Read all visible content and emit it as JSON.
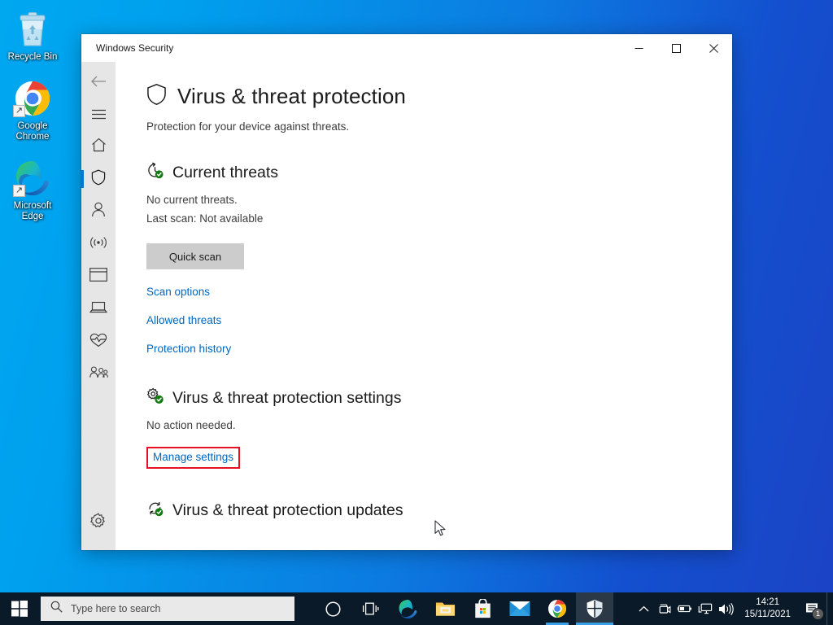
{
  "desktop": {
    "icons": [
      {
        "name": "recycle-bin",
        "label": "Recycle Bin"
      },
      {
        "name": "google-chrome",
        "label": "Google Chrome"
      },
      {
        "name": "microsoft-edge",
        "label": "Microsoft Edge"
      }
    ]
  },
  "window": {
    "title": "Windows Security",
    "controls": {
      "minimize": "—",
      "maximize": "☐",
      "close": "✕"
    }
  },
  "sidebar": {
    "items": [
      {
        "name": "back-arrow-icon",
        "label": "Back"
      },
      {
        "name": "hamburger-menu-icon",
        "label": "Menu"
      },
      {
        "name": "home-icon",
        "label": "Home"
      },
      {
        "name": "shield-icon",
        "label": "Virus & threat protection"
      },
      {
        "name": "person-icon",
        "label": "Account protection"
      },
      {
        "name": "wifi-icon",
        "label": "Firewall & network protection"
      },
      {
        "name": "app-window-icon",
        "label": "App & browser control"
      },
      {
        "name": "laptop-icon",
        "label": "Device security"
      },
      {
        "name": "heart-pulse-icon",
        "label": "Device performance & health"
      },
      {
        "name": "family-icon",
        "label": "Family options"
      },
      {
        "name": "gear-icon",
        "label": "Settings"
      }
    ]
  },
  "page": {
    "title": "Virus & threat protection",
    "subtitle": "Protection for your device against threats."
  },
  "sections": {
    "current_threats": {
      "title": "Current threats",
      "icon": "history-check-icon",
      "line1": "No current threats.",
      "line2": "Last scan: Not available",
      "button": "Quick scan",
      "links": [
        "Scan options",
        "Allowed threats",
        "Protection history"
      ]
    },
    "settings": {
      "title": "Virus & threat protection settings",
      "icon": "gear-check-icon",
      "line1": "No action needed.",
      "link": "Manage settings",
      "highlighted": true,
      "highlight_color": "#e81123"
    },
    "updates": {
      "title": "Virus & threat protection updates",
      "icon": "refresh-check-icon"
    }
  },
  "taskbar": {
    "start": "start-button",
    "search": {
      "placeholder": "Type here to search",
      "icon": "search-icon"
    },
    "icons": [
      {
        "name": "cortana-icon",
        "label": "Cortana"
      },
      {
        "name": "task-view-icon",
        "label": "Task View"
      },
      {
        "name": "microsoft-edge-icon",
        "label": "Microsoft Edge"
      },
      {
        "name": "file-explorer-icon",
        "label": "File Explorer"
      },
      {
        "name": "microsoft-store-icon",
        "label": "Microsoft Store"
      },
      {
        "name": "mail-icon",
        "label": "Mail"
      },
      {
        "name": "google-chrome-icon",
        "label": "Google Chrome"
      },
      {
        "name": "windows-security-icon",
        "label": "Windows Security"
      }
    ],
    "tray": [
      {
        "name": "show-hidden-icons-chevron",
        "label": "Show hidden icons"
      },
      {
        "name": "onedrive-icon",
        "label": "OneDrive"
      },
      {
        "name": "battery-icon",
        "label": "Battery"
      },
      {
        "name": "network-icon",
        "label": "Network"
      },
      {
        "name": "volume-icon",
        "label": "Volume"
      }
    ],
    "clock": {
      "time": "14:21",
      "date": "15/11/2021"
    },
    "notifications": {
      "icon": "action-center-icon",
      "count": "1"
    }
  },
  "colors": {
    "accent": "#0078d7",
    "link": "#0067c0",
    "highlight": "#e81123",
    "taskbar": "#0b1a28",
    "sidebar": "#e6e6e6",
    "green_check": "#107c10"
  }
}
